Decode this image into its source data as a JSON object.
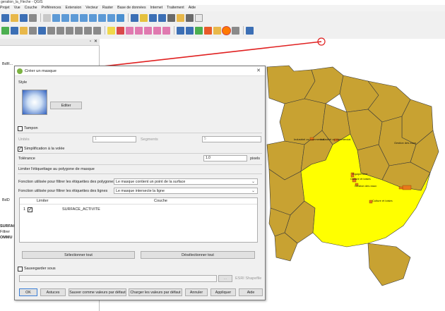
{
  "window": {
    "title": "geration_la_Fleche - QGIS"
  },
  "menu": [
    "Projet",
    "Vue",
    "Couche",
    "Préférences",
    "Extension",
    "Vecteur",
    "Raster",
    "Base de données",
    "Internet",
    "Traitement",
    "Aide"
  ],
  "dialog": {
    "title": "Créer un masque",
    "style_group": "Style",
    "edit_button": "Editer",
    "buffer_label": "Tampon",
    "unit_label": "Unités",
    "unit_value": "1",
    "segments_label": "Segments",
    "segments_value": "5",
    "simplify_label": "Simplification à la volée",
    "tolerance_label": "Tolérance",
    "tolerance_value": "1.0",
    "tolerance_unit": "pixels",
    "limit_section": "Limiter l'étiquettage au polygone de masque",
    "polygon_filter_label": "Fonction utilisée pour filtrer les étiquettes des polygones",
    "polygon_filter_value": "Le masque contient un point de la surface",
    "line_filter_label": "Fonction utilisée pour filtrer les étiquettes des lignes",
    "line_filter_value": "Le masque intersecte la ligne",
    "table": {
      "headers": [
        "Limiter",
        "Couche"
      ],
      "rows": [
        {
          "index": "1",
          "checked": true,
          "layer": "SURFACE_ACTIVITE"
        }
      ]
    },
    "select_all": "Sélectionner tout",
    "deselect_all": "Désélectionner tout",
    "save_under": "Sauvegarder sous",
    "browse_button": "...",
    "format_label": "ESRI Shapefile",
    "buttons": {
      "ok": "OK",
      "tips": "Astuces",
      "save_defaults": "Sauver comme valeurs par défaut",
      "load_defaults": "Charger les valeurs par défaut",
      "cancel": "Annuler",
      "apply": "Appliquer",
      "help": "Aide"
    }
  },
  "map": {
    "labels": [
      "Industriel ou commercial",
      "Industriel ou commercial",
      "Gestion des eaux",
      "Equipement",
      "Culture et loisirs",
      "Gestion des eaux",
      "Culture et loisirs"
    ],
    "colors": {
      "mask_fill": "#c8a232",
      "highlight": "#ffff00",
      "activity": "#e8791a"
    }
  },
  "left_panel": {
    "layer_fragments": [
      "BdR...",
      "BdD",
      "SURFAC",
      "Filtrer",
      "OMMU"
    ]
  }
}
